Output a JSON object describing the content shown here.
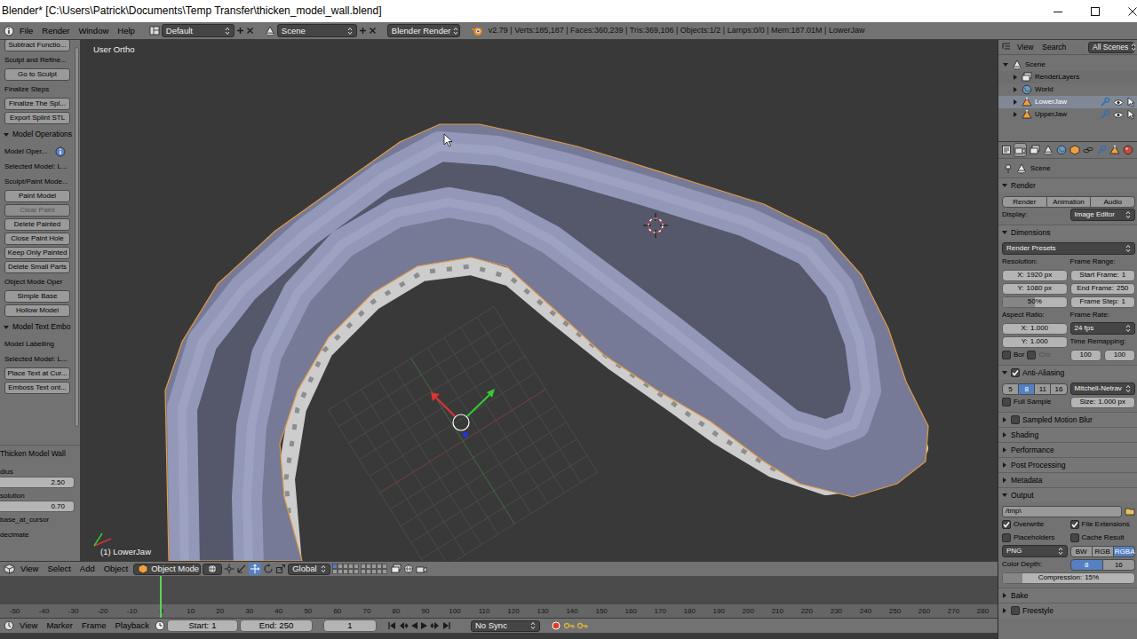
{
  "window": {
    "title": "Blender* [C:\\Users\\Patrick\\Documents\\Temp Transfer\\thicken_model_wall.blend]"
  },
  "info_header": {
    "menus": [
      "File",
      "Render",
      "Window",
      "Help"
    ],
    "layout": "Default",
    "scene": "Scene",
    "engine": "Blender Render",
    "stats": "v2.79 | Verts:185,187 | Faces:360,239 | Tris:369,106 | Objects:1/2 | Lamps:0/0 | Mem:187.01M | LowerJaw"
  },
  "tool_shelf": {
    "items": [
      {
        "kind": "button",
        "label": "Subtract Functio...",
        "disabled": false
      },
      {
        "kind": "label",
        "label": "Sculpt and Refine...",
        "disabled": false
      },
      {
        "kind": "button",
        "label": "Go to Sculpt",
        "disabled": false
      },
      {
        "kind": "label",
        "label": "Finalize Steps",
        "disabled": false
      },
      {
        "kind": "button",
        "label": "Finalize The Spl...",
        "disabled": false
      },
      {
        "kind": "button",
        "label": "Export Splint STL",
        "disabled": false
      },
      {
        "kind": "header",
        "label": "Model Operations",
        "expanded": true,
        "disabled": false
      },
      {
        "kind": "info",
        "label": "Model Oper...",
        "disabled": false
      },
      {
        "kind": "label",
        "label": "Selected Model: L...",
        "disabled": false
      },
      {
        "kind": "label",
        "label": "Sculpt/Paint Mode...",
        "disabled": false
      },
      {
        "kind": "button",
        "label": "Paint Model",
        "disabled": false
      },
      {
        "kind": "button",
        "label": "Clear Paint",
        "disabled": true
      },
      {
        "kind": "button",
        "label": "Delete Painted",
        "disabled": false
      },
      {
        "kind": "button",
        "label": "Close Paint Hole",
        "disabled": false
      },
      {
        "kind": "button",
        "label": "Keep Only Painted",
        "disabled": false
      },
      {
        "kind": "button",
        "label": "Delete Small Parts",
        "disabled": false
      },
      {
        "kind": "label",
        "label": "Object Mode Oper",
        "disabled": false
      },
      {
        "kind": "button",
        "label": "Simple Base",
        "disabled": false
      },
      {
        "kind": "button",
        "label": "Hollow Model",
        "disabled": false
      },
      {
        "kind": "header",
        "label": "Model Text Embo",
        "expanded": true,
        "disabled": false
      },
      {
        "kind": "label",
        "label": "Model Labelling",
        "disabled": false
      },
      {
        "kind": "label",
        "label": "Selected Model: L...",
        "disabled": false
      },
      {
        "kind": "button",
        "label": "Place Text at Cur...",
        "disabled": false
      },
      {
        "kind": "button",
        "label": "Emboss Text ont...",
        "disabled": false
      }
    ]
  },
  "operator_panel": {
    "title": "Thicken Model Wall",
    "fields": [
      {
        "label": "dius",
        "value": "2.50"
      },
      {
        "label": "solution",
        "value": "0.70"
      }
    ],
    "options": [
      "base_at_cursor",
      "decimate"
    ]
  },
  "viewport": {
    "view_name": "User Ortho",
    "object_label": "(1) LowerJaw"
  },
  "viewport_header": {
    "menus": [
      "View",
      "Select",
      "Add",
      "Object"
    ],
    "mode": "Object Mode",
    "orientation": "Global"
  },
  "timeline": {
    "ticks": [
      "-50",
      "-40",
      "-30",
      "-20",
      "-10",
      "0",
      "10",
      "20",
      "30",
      "40",
      "50",
      "60",
      "70",
      "80",
      "90",
      "100",
      "110",
      "120",
      "130",
      "140",
      "150",
      "160",
      "170",
      "180",
      "190",
      "200",
      "210",
      "220",
      "230",
      "240",
      "250",
      "260",
      "270",
      "280"
    ],
    "playhead_level": 0.16
  },
  "timeline_header": {
    "menus": [
      "View",
      "Marker",
      "Frame",
      "Playback"
    ],
    "start_label": "Start:",
    "start": "1",
    "end_label": "End:",
    "end": "250",
    "current": "1",
    "sync": "No Sync"
  },
  "outliner": {
    "menus": [
      "View",
      "Search"
    ],
    "filter": "All Scenes",
    "tree": [
      {
        "label": "Scene",
        "kind": "scene",
        "expanded": true,
        "selected": false,
        "children": [
          {
            "label": "RenderLayers",
            "kind": "renderlayers",
            "expanded": false,
            "selected": false
          },
          {
            "label": "World",
            "kind": "world",
            "expanded": false,
            "selected": false
          },
          {
            "label": "LowerJaw",
            "kind": "mesh",
            "expanded": false,
            "selected": true
          },
          {
            "label": "UpperJaw",
            "kind": "mesh",
            "expanded": false,
            "selected": false
          }
        ]
      }
    ]
  },
  "properties": {
    "tabs": [
      {
        "kind": "render",
        "selected": true
      },
      {
        "kind": "layers",
        "selected": false
      },
      {
        "kind": "scene",
        "selected": false
      },
      {
        "kind": "world",
        "selected": false
      },
      {
        "kind": "object",
        "selected": false
      },
      {
        "kind": "constraint",
        "selected": false
      },
      {
        "kind": "modifier",
        "selected": false
      },
      {
        "kind": "data",
        "selected": false
      },
      {
        "kind": "material",
        "selected": false
      }
    ],
    "breadcrumb": "Scene",
    "panels": [
      {
        "title": "Render",
        "expanded": true,
        "rows": [
          {
            "cells": [
              {
                "kind": "toggles",
                "items": [
                  {
                    "label": "Render",
                    "selected": false
                  },
                  {
                    "label": "Animation",
                    "selected": false
                  },
                  {
                    "label": "Audio",
                    "selected": false
                  }
                ]
              }
            ]
          },
          {
            "cells": [
              {
                "kind": "label",
                "label": "Display:"
              },
              {
                "kind": "dropdown",
                "value": "Image Editor"
              }
            ]
          }
        ]
      },
      {
        "title": "Dimensions",
        "expanded": true,
        "rows": [
          {
            "cells": [
              {
                "kind": "dropdown",
                "value": "Render Presets"
              }
            ]
          },
          {
            "cells": [
              {
                "kind": "label",
                "label": "Resolution:"
              },
              {
                "kind": "label",
                "label": "Frame Range:"
              }
            ]
          },
          {
            "cells": [
              {
                "kind": "field",
                "label": "X:",
                "value": "1920 px"
              },
              {
                "kind": "field",
                "label": "Start Frame:",
                "value": "1"
              }
            ]
          },
          {
            "cells": [
              {
                "kind": "field",
                "label": "Y:",
                "value": "1080 px"
              },
              {
                "kind": "field",
                "label": "End Frame:",
                "value": "250"
              }
            ]
          },
          {
            "cells": [
              {
                "kind": "slider",
                "value": "50%",
                "level": 0.5
              },
              {
                "kind": "field",
                "label": "Frame Step:",
                "value": "1"
              }
            ]
          },
          {
            "cells": [
              {
                "kind": "label",
                "label": "Aspect Ratio:"
              },
              {
                "kind": "label",
                "label": "Frame Rate:"
              }
            ]
          },
          {
            "cells": [
              {
                "kind": "field",
                "label": "X:",
                "value": "1.000"
              },
              {
                "kind": "dropdown",
                "value": "24 fps"
              }
            ]
          },
          {
            "cells": [
              {
                "kind": "field",
                "label": "Y:",
                "value": "1.000"
              },
              {
                "kind": "label",
                "label": "Time Remapping:"
              }
            ]
          },
          {
            "cells": [
              {
                "kind": "checks",
                "items": [
                  {
                    "label": "Bor",
                    "checked": false,
                    "disabled": false
                  },
                  {
                    "label": "Cro",
                    "checked": false,
                    "disabled": true
                  }
                ]
              },
              {
                "kind": "fields",
                "values": [
                  "100",
                  "100"
                ]
              }
            ]
          }
        ]
      },
      {
        "title": "Anti-Aliasing",
        "expanded": true,
        "checked": true,
        "rows": [
          {
            "cells": [
              {
                "kind": "toggles",
                "items": [
                  {
                    "label": "5",
                    "selected": false
                  },
                  {
                    "label": "8",
                    "selected": true
                  },
                  {
                    "label": "11",
                    "selected": false
                  },
                  {
                    "label": "16",
                    "selected": false
                  }
                ]
              },
              {
                "kind": "dropdown",
                "value": "Mitchell-Netrav"
              }
            ]
          },
          {
            "cells": [
              {
                "kind": "checks",
                "items": [
                  {
                    "label": "Full Sample",
                    "checked": false,
                    "disabled": false
                  }
                ]
              },
              {
                "kind": "field",
                "label": "Size:",
                "value": "1.000 px"
              }
            ]
          }
        ]
      },
      {
        "title": "Sampled Motion Blur",
        "expanded": false,
        "checked": false,
        "rows": []
      },
      {
        "title": "Shading",
        "expanded": false,
        "rows": []
      },
      {
        "title": "Performance",
        "expanded": false,
        "rows": []
      },
      {
        "title": "Post Processing",
        "expanded": false,
        "rows": []
      },
      {
        "title": "Metadata",
        "expanded": false,
        "rows": []
      },
      {
        "title": "Output",
        "expanded": true,
        "rows": [
          {
            "cells": [
              {
                "kind": "path",
                "value": "/tmp\\"
              }
            ]
          },
          {
            "cells": [
              {
                "kind": "checks",
                "items": [
                  {
                    "label": "Overwrite",
                    "checked": true,
                    "disabled": false
                  }
                ]
              },
              {
                "kind": "checks",
                "items": [
                  {
                    "label": "File Extensions",
                    "checked": true,
                    "disabled": false
                  }
                ]
              }
            ]
          },
          {
            "cells": [
              {
                "kind": "checks",
                "items": [
                  {
                    "label": "Placeholders",
                    "checked": false,
                    "disabled": false
                  }
                ]
              },
              {
                "kind": "checks",
                "items": [
                  {
                    "label": "Cache Result",
                    "checked": false,
                    "disabled": false
                  }
                ]
              }
            ]
          },
          {
            "cells": [
              {
                "kind": "dropdown",
                "value": "PNG"
              },
              {
                "kind": "toggles",
                "items": [
                  {
                    "label": "BW",
                    "selected": false
                  },
                  {
                    "label": "RGB",
                    "selected": false
                  },
                  {
                    "label": "RGBA",
                    "selected": true
                  }
                ]
              }
            ]
          },
          {
            "cells": [
              {
                "kind": "label",
                "label": "Color Depth:"
              },
              {
                "kind": "toggles",
                "items": [
                  {
                    "label": "8",
                    "selected": true
                  },
                  {
                    "label": "16",
                    "selected": false
                  }
                ]
              }
            ]
          },
          {
            "cells": [
              {
                "kind": "slider",
                "label": "Compression:",
                "value": "15%",
                "level": 0.15
              }
            ]
          }
        ]
      },
      {
        "title": "Bake",
        "expanded": false,
        "rows": []
      },
      {
        "title": "Freestyle",
        "expanded": false,
        "checked": false,
        "rows": []
      }
    ]
  }
}
